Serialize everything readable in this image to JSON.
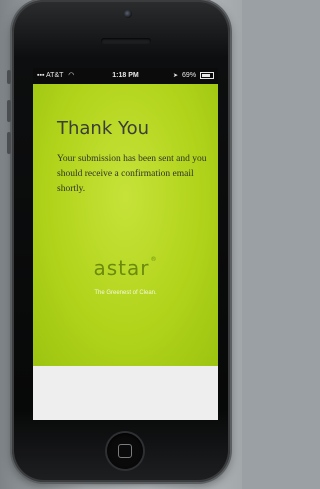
{
  "status_bar": {
    "carrier": "AT&T",
    "time": "1:18 PM",
    "battery": "69%"
  },
  "page": {
    "title": "Thank You",
    "message": "Your submission has been sent and you should receive a confirmation email shortly."
  },
  "brand": {
    "logo_text": "astar",
    "registered_mark": "®",
    "tagline": "The Greenest of Clean."
  },
  "colors": {
    "screen_accent": "#b5d61e",
    "logo": "#6c8a0e"
  },
  "icons": [
    "signal-icon",
    "wifi-icon",
    "location-arrow-icon",
    "battery-icon",
    "home-button-icon"
  ]
}
